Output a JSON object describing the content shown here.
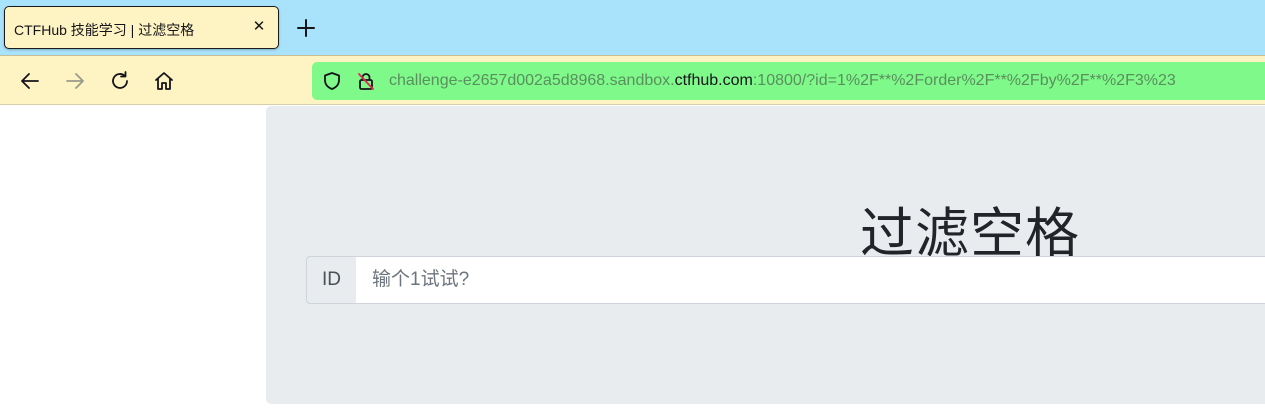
{
  "browser": {
    "tab": {
      "title": "CTFHub 技能学习 | 过滤空格",
      "close_glyph": "✕"
    },
    "new_tab_icon": "plus-icon",
    "nav": {
      "back_icon": "arrow-left-icon",
      "forward_icon": "arrow-right-icon",
      "reload_icon": "reload-icon",
      "home_icon": "home-icon"
    },
    "url": {
      "prefix": "challenge-e2657d002a5d8968.sandbox.",
      "host": "ctfhub.com",
      "suffix": ":10800/?id=1%2F**%2Forder%2F**%2Fby%2F**%2F3%23"
    }
  },
  "page": {
    "title": "过滤空格",
    "input_group": {
      "addon_label": "ID",
      "placeholder": "输个1试试?",
      "value": ""
    }
  },
  "colors": {
    "tab_strip_bg": "#a9e2fb",
    "toolbar_bg": "#fef4c3",
    "urlbar_bg": "#7ef98a",
    "jumbotron_bg": "#e9ecef"
  }
}
